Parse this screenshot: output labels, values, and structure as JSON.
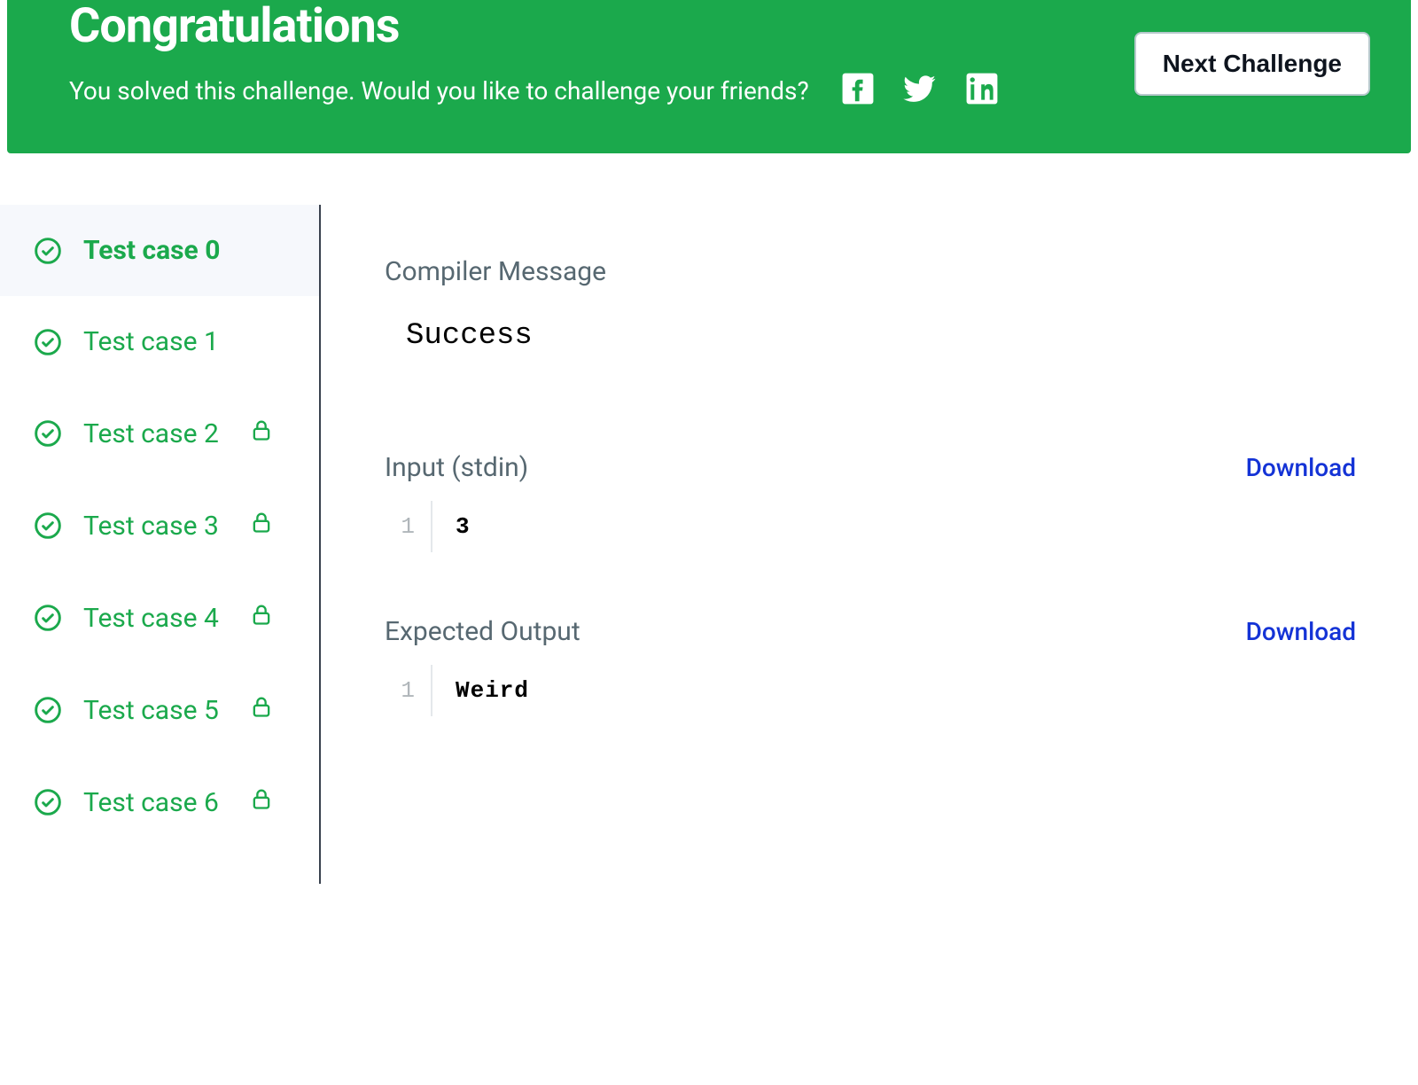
{
  "banner": {
    "title": "Congratulations",
    "subtitle": "You solved this challenge. Would you like to challenge your friends?",
    "next_button": "Next Challenge"
  },
  "sidebar": {
    "items": [
      {
        "label": "Test case 0",
        "locked": false,
        "active": true
      },
      {
        "label": "Test case 1",
        "locked": false,
        "active": false
      },
      {
        "label": "Test case 2",
        "locked": true,
        "active": false
      },
      {
        "label": "Test case 3",
        "locked": true,
        "active": false
      },
      {
        "label": "Test case 4",
        "locked": true,
        "active": false
      },
      {
        "label": "Test case 5",
        "locked": true,
        "active": false
      },
      {
        "label": "Test case 6",
        "locked": true,
        "active": false
      }
    ]
  },
  "main": {
    "compiler_label": "Compiler Message",
    "compiler_message": "Success",
    "input_label": "Input (stdin)",
    "input_download": "Download",
    "input_lineno": "1",
    "input_value": "3",
    "expected_label": "Expected Output",
    "expected_download": "Download",
    "expected_lineno": "1",
    "expected_value": "Weird"
  }
}
